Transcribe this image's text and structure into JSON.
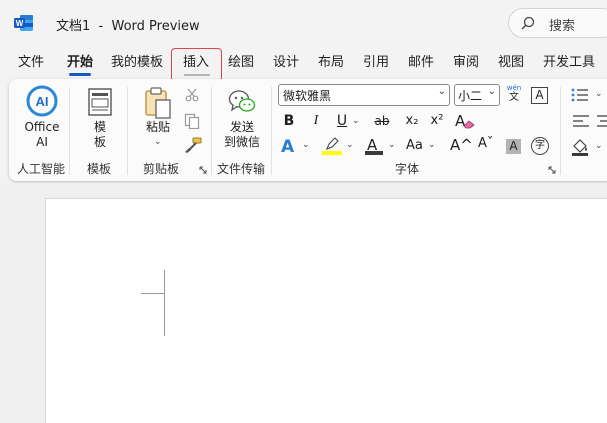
{
  "titlebar": {
    "title": "文档1  -  Word Preview",
    "search_label": "搜索"
  },
  "menu": {
    "items": [
      "文件",
      "开始",
      "我的模板",
      "插入",
      "绘图",
      "设计",
      "布局",
      "引用",
      "邮件",
      "审阅",
      "视图",
      "开发工具"
    ],
    "active": "开始",
    "highlighted": "插入"
  },
  "ribbon": {
    "office_ai": {
      "label1": "Office",
      "label2": "AI",
      "icon_text": "AI"
    },
    "template": {
      "label1": "模",
      "label2": "板"
    },
    "paste": {
      "label": "粘贴"
    },
    "send": {
      "label1": "发送",
      "label2": "到微信"
    },
    "font": {
      "name": "微软雅黑",
      "size": "小二",
      "pinyin_top": "wén",
      "pinyin_bottom": "文",
      "border_char": "A",
      "bold": "B",
      "italic": "I",
      "underline": "U",
      "strike": "ab",
      "subscript": "x₂",
      "superscript": "x²",
      "clear": "A",
      "text_effect": "A",
      "highlight": "ab",
      "font_color": "A",
      "case": "Aa",
      "grow": "A^",
      "shrink": "Aˇ",
      "shading": "A",
      "enclose": "字"
    },
    "groups": {
      "ai": "人工智能",
      "template": "模板",
      "clipboard": "剪贴板",
      "transfer": "文件传输",
      "font": "字体"
    }
  },
  "colors": {
    "accent": "#185abd",
    "highlight_outline": "#e0434c",
    "highlight_yellow": "#ffff00",
    "font_red": "#c00000"
  }
}
